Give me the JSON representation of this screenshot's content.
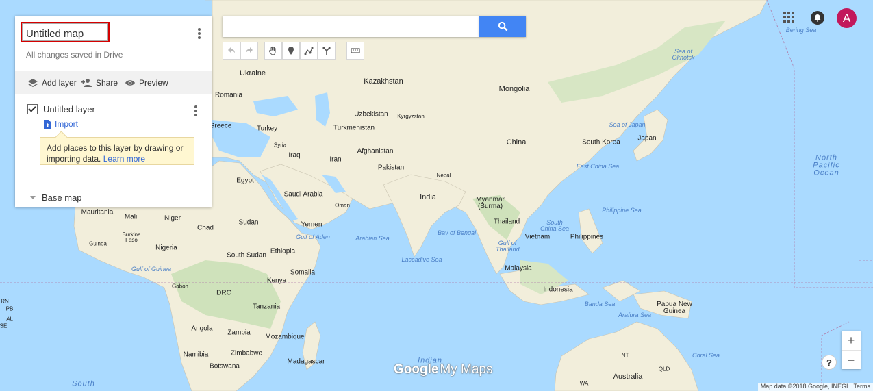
{
  "panel": {
    "map_title": "Untitled map",
    "saved_status": "All changes saved in Drive",
    "actions": {
      "add_layer": "Add layer",
      "share": "Share",
      "preview": "Preview"
    },
    "layer": {
      "name": "Untitled layer",
      "import_label": "Import",
      "checked": true
    },
    "tip": {
      "text": "Add places to this layer by drawing or importing data.",
      "link": "Learn more"
    },
    "base_map_label": "Base map"
  },
  "search": {
    "placeholder": "",
    "value": ""
  },
  "toolbar": [
    "undo-icon",
    "redo-icon",
    "hand-icon",
    "marker-icon",
    "draw-line-icon",
    "directions-icon",
    "ruler-icon"
  ],
  "header": {
    "avatar_letter": "A"
  },
  "map": {
    "countries": [
      "Ukraine",
      "Kazakhstan",
      "Mongolia",
      "Romania",
      "Uzbekistan",
      "Kyrgyzstan",
      "Greece",
      "Turkey",
      "Turkmenistan",
      "China",
      "South Korea",
      "Japan",
      "Syria",
      "Iraq",
      "Iran",
      "Afghanistan",
      "Pakistan",
      "Nepal",
      "Egypt",
      "Saudi Arabia",
      "Oman",
      "India",
      "Myanmar (Burma)",
      "Mauritania",
      "Mali",
      "Niger",
      "Chad",
      "Sudan",
      "Yemen",
      "Thailand",
      "Burkina Faso",
      "Guinea",
      "Nigeria",
      "South Sudan",
      "Ethiopia",
      "Vietnam",
      "Philippines",
      "Gabon",
      "Kenya",
      "Somalia",
      "Malaysia",
      "DRC",
      "Indonesia",
      "Tanzania",
      "Papua New Guinea",
      "Angola",
      "Zambia",
      "Mozambique",
      "Namibia",
      "Zimbabwe",
      "Botswana",
      "Madagascar",
      "Australia",
      "NT",
      "QLD",
      "WA"
    ],
    "seas": [
      "Bering Sea",
      "Sea of Okhotsk",
      "Sea of Japan",
      "East China Sea",
      "Philippine Sea",
      "South China Sea",
      "Gulf of Aden",
      "Arabian Sea",
      "Bay of Bengal",
      "Gulf of Thailand",
      "Laccadive Sea",
      "Gulf of Guinea",
      "Banda Sea",
      "Arafura Sea",
      "Coral Sea",
      "Indian",
      "North Pacific Ocean",
      "South"
    ],
    "edge_labels": [
      "RN",
      "PB",
      "AL",
      "SE"
    ]
  },
  "branding": {
    "google": "Google",
    "my_maps": "My Maps"
  },
  "attribution": {
    "data": "Map data ©2018 Google, INEGI",
    "terms": "Terms"
  },
  "controls": {
    "zoom_in": "+",
    "zoom_out": "−",
    "help": "?"
  },
  "colors": {
    "water": "#aadaff",
    "land": "#f5f0dc",
    "forest": "#c5dcb0",
    "accent": "#4285f4",
    "avatar": "#c2185b",
    "highlight": "#d50000"
  }
}
